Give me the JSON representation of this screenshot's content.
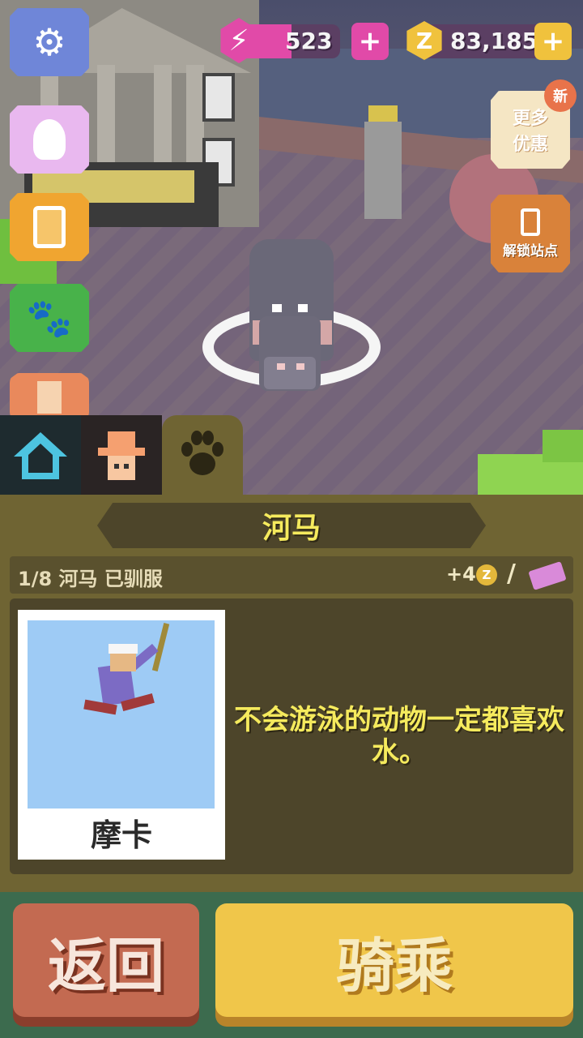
{
  "hud": {
    "energy": "523",
    "coins": "83,185",
    "coin_symbol": "Z",
    "plus": "+"
  },
  "right_menu": {
    "deals_label_line1": "更多",
    "deals_label_line2": "优惠",
    "new_badge": "新",
    "unlock_label": "解锁站点"
  },
  "panel": {
    "animal_name": "河马",
    "tamed_status": "1/8 河马 已驯服",
    "reward": "+4",
    "reward_coin_symbol": "Z",
    "separator": "/",
    "card_name": "摩卡",
    "quote": "不会游泳的动物一定都喜欢水。"
  },
  "buttons": {
    "back": "返回",
    "ride": "骑乘"
  },
  "icons": {
    "settings": "gear-icon",
    "hints": "lightbulb-icon",
    "missions": "clipboard-icon",
    "zoo": "paw-icon",
    "home_tab": "house-icon",
    "ranger_tab": "cowboy-icon",
    "animal_tab": "paw-icon",
    "energy": "lightning-icon",
    "coin": "coin-icon",
    "ticket": "ticket-icon"
  },
  "colors": {
    "panel_bg": "#6f6433",
    "title_text": "#f5ea5d",
    "back_button": "#c36a51",
    "ride_button": "#f0c64a",
    "energy": "#e14aa8",
    "coin": "#f0c23d"
  }
}
